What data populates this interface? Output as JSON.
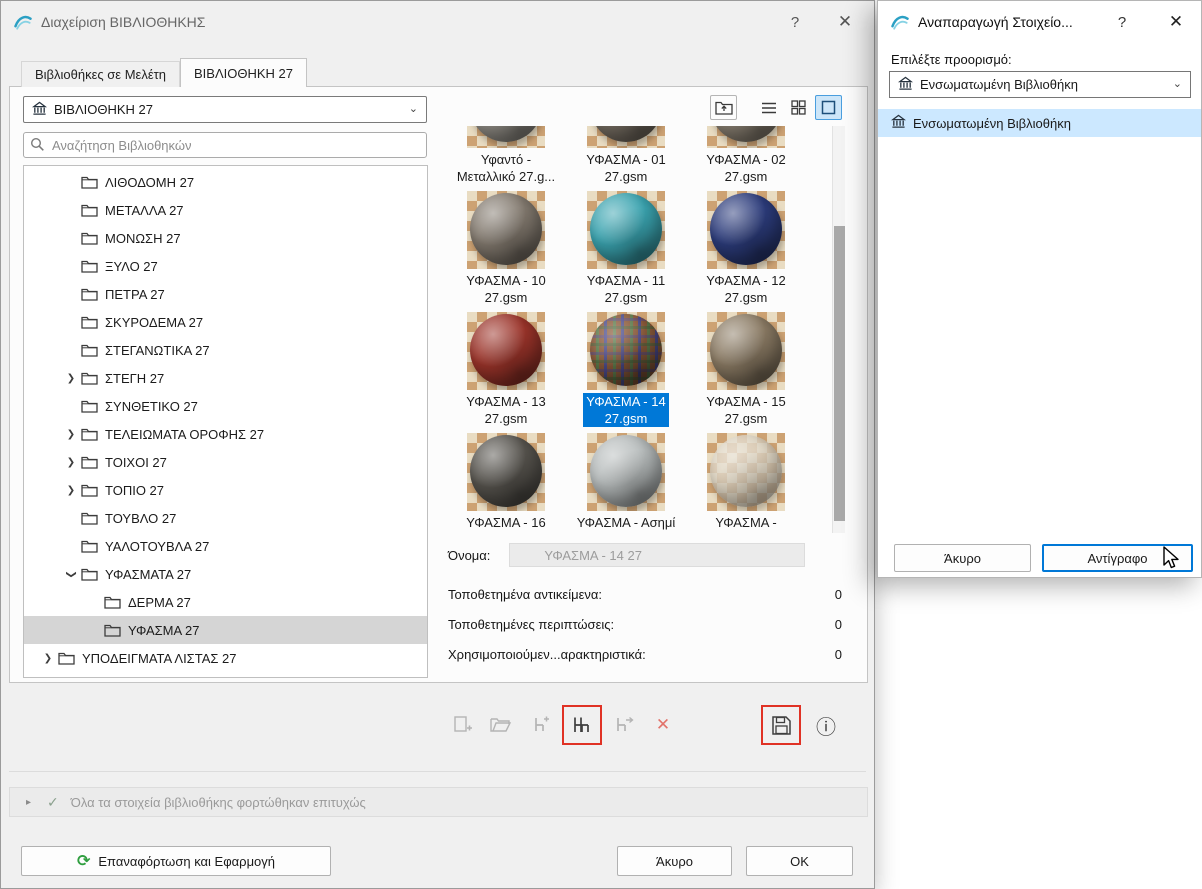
{
  "glyphs": {
    "help": "?",
    "close": "✕",
    "chevron_down": "⌄",
    "tree_chevron": "❯",
    "status_chevron": "▸",
    "check": "✓",
    "reload": "⟳",
    "delete": "✕",
    "info": "ⓘ"
  },
  "colors": {
    "accent_blue": "#0078d7",
    "selection_light_blue": "#cce8ff",
    "thumbnail_selected_bg": "#0078d7",
    "annotation_red": "#e03225",
    "tree_selected_gray": "#d5d5d5",
    "reload_icon_green": "#2f9e3f"
  },
  "main_dialog": {
    "title": "Διαχείριση ΒΙΒΛΙΟΘΗΚΗΣ",
    "tabs": [
      {
        "label": "Βιβλιοθήκες σε Μελέτη",
        "active": false
      },
      {
        "label": "ΒΙΒΛΙΟΘΗΚΗ 27",
        "active": true
      }
    ],
    "library_dropdown": {
      "value": "ΒΙΒΛΙΟΘΗΚΗ 27"
    },
    "view_buttons": [
      {
        "name": "up-one-level"
      },
      {
        "name": "list-view"
      },
      {
        "name": "grid-view"
      },
      {
        "name": "large-icons-view",
        "selected": true
      }
    ],
    "search": {
      "placeholder": "Αναζήτηση Βιβλιοθηκών"
    },
    "tree": {
      "items": [
        {
          "label": "ΛΙΘΟΔΟΜΗ 27",
          "level": 2,
          "chevron": "none"
        },
        {
          "label": "ΜΕΤΑΛΛΑ 27",
          "level": 2,
          "chevron": "none"
        },
        {
          "label": "ΜΟΝΩΣΗ 27",
          "level": 2,
          "chevron": "none"
        },
        {
          "label": "ΞΥΛΟ 27",
          "level": 2,
          "chevron": "none"
        },
        {
          "label": "ΠΕΤΡΑ 27",
          "level": 2,
          "chevron": "none"
        },
        {
          "label": "ΣΚΥΡΟΔΕΜΑ 27",
          "level": 2,
          "chevron": "none"
        },
        {
          "label": "ΣΤΕΓΑΝΩΤΙΚΑ 27",
          "level": 2,
          "chevron": "none"
        },
        {
          "label": "ΣΤΕΓΗ 27",
          "level": 2,
          "chevron": "collapsed"
        },
        {
          "label": "ΣΥΝΘΕΤΙΚΟ 27",
          "level": 2,
          "chevron": "none"
        },
        {
          "label": "ΤΕΛΕΙΩΜΑΤΑ ΟΡΟΦΗΣ 27",
          "level": 2,
          "chevron": "collapsed"
        },
        {
          "label": "ΤΟΙΧΟΙ 27",
          "level": 2,
          "chevron": "collapsed"
        },
        {
          "label": "ΤΟΠΙΟ 27",
          "level": 2,
          "chevron": "collapsed"
        },
        {
          "label": "ΤΟΥΒΛΟ 27",
          "level": 2,
          "chevron": "none"
        },
        {
          "label": "ΥΑΛΟΤΟΥΒΛΑ 27",
          "level": 2,
          "chevron": "none"
        },
        {
          "label": "ΥΦΑΣΜΑΤΑ 27",
          "level": 2,
          "chevron": "expanded"
        },
        {
          "label": "ΔΕΡΜΑ 27",
          "level": 3,
          "chevron": "none"
        },
        {
          "label": "ΥΦΑΣΜΑ 27",
          "level": 3,
          "chevron": "none",
          "selected": true
        },
        {
          "label": "ΥΠΟΔΕΙΓΜΑΤΑ ΛΙΣΤΑΣ 27",
          "level": 1,
          "chevron": "collapsed"
        }
      ]
    },
    "thumbnails": [
      {
        "line1": "Υφαντό -",
        "line2": "Μεταλλικό 27.g...",
        "color": "#9a968e",
        "partial_top": true
      },
      {
        "line1": "ΥΦΑΣΜΑ - 01",
        "line2": "27.gsm",
        "color": "#7d7468",
        "partial_top": true
      },
      {
        "line1": "ΥΦΑΣΜΑ - 02",
        "line2": "27.gsm",
        "color": "#93897a",
        "partial_top": true
      },
      {
        "line1": "ΥΦΑΣΜΑ - 10",
        "line2": "27.gsm",
        "color": "#837a6f"
      },
      {
        "line1": "ΥΦΑΣΜΑ - 11",
        "line2": "27.gsm",
        "color": "#3aa4b0"
      },
      {
        "line1": "ΥΦΑΣΜΑ - 12",
        "line2": "27.gsm",
        "color": "#2c3c7c"
      },
      {
        "line1": "ΥΦΑΣΜΑ - 13",
        "line2": "27.gsm",
        "color": "#9c342a"
      },
      {
        "line1": "ΥΦΑΣΜΑ - 14",
        "line2": "27.gsm",
        "color": "#7a5a40",
        "plaid": true,
        "selected": true
      },
      {
        "line1": "ΥΦΑΣΜΑ - 15",
        "line2": "27.gsm",
        "color": "#8b7b64"
      },
      {
        "line1": "ΥΦΑΣΜΑ - 16",
        "line2": "",
        "color": "#57544e"
      },
      {
        "line1": "ΥΦΑΣΜΑ - Ασημί",
        "line2": "",
        "color": "#b7bcbc"
      },
      {
        "line1": "ΥΦΑΣΜΑ -",
        "line2": "",
        "color": "#ded6c6",
        "glass": true
      }
    ],
    "info": {
      "name_label": "Όνομα:",
      "name_value": "ΥΦΑΣΜΑ - 14 27",
      "rows": [
        {
          "label": "Τοποθετημένα αντικείμενα:",
          "value": "0"
        },
        {
          "label": "Τοποθετημένες περιπτώσεις:",
          "value": "0"
        },
        {
          "label": "Χρησιμοποιούμεν...αρακτηριστικά:",
          "value": "0"
        }
      ]
    },
    "toolbar": {
      "buttons": [
        {
          "name": "new-library-part",
          "enabled": false
        },
        {
          "name": "open-library-part",
          "enabled": false
        },
        {
          "name": "add-object",
          "enabled": false
        },
        {
          "name": "duplicate-object",
          "enabled": true,
          "annotated": true
        },
        {
          "name": "export-object",
          "enabled": false
        },
        {
          "name": "delete-object",
          "enabled": true
        }
      ],
      "right_buttons": [
        {
          "name": "save-as",
          "enabled": true,
          "annotated": true
        },
        {
          "name": "info",
          "enabled": true
        }
      ]
    },
    "status": {
      "message": "Όλα τα στοιχεία βιβλιοθήκης φορτώθηκαν επιτυχώς"
    },
    "footer": {
      "reload": "Επαναφόρτωση και Εφαρμογή",
      "cancel": "Άκυρο",
      "ok": "OK"
    }
  },
  "duplicate_dialog": {
    "title": "Αναπαραγωγή Στοιχείο...",
    "destination_label": "Επιλέξτε προορισμό:",
    "dropdown": {
      "value": "Ενσωματωμένη Βιβλιοθήκη"
    },
    "list": [
      {
        "label": "Ενσωματωμένη Βιβλιοθήκη",
        "selected": true
      }
    ],
    "buttons": {
      "cancel": "Άκυρο",
      "copy": "Αντίγραφο"
    }
  }
}
